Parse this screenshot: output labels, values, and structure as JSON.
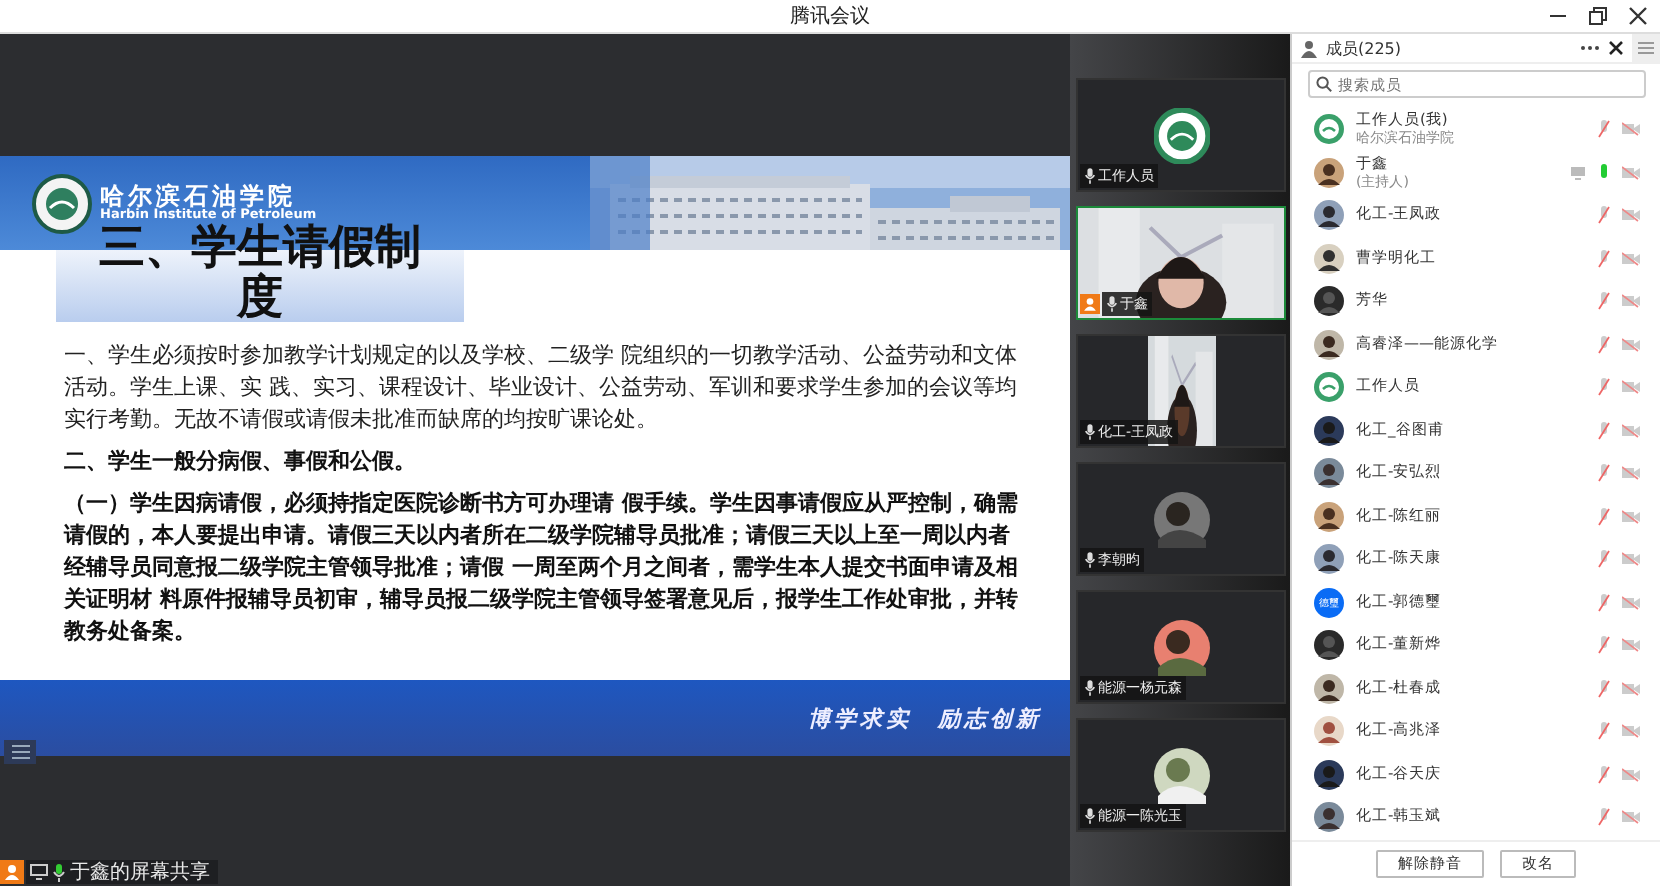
{
  "window": {
    "title": "腾讯会议"
  },
  "slide": {
    "school_name": "哈尔滨石油学院",
    "school_name_en": "Harbin Institute of Petroleum",
    "title": "三、学生请假制度",
    "paragraphs": [
      {
        "kind": "normal",
        "text": "一、学生必须按时参加教学计划规定的以及学校、二级学 院组织的一切教学活动、公益劳动和文体活动。学生上课、实 践、实习、课程设计、毕业设计、公益劳动、军训和要求学生参加的会议等均实行考勤。无故不请假或请假未批准而缺席的均按旷课论处。"
      },
      {
        "kind": "bold",
        "text": "二、学生一般分病假、事假和公假。"
      },
      {
        "kind": "bold",
        "text": "（一）学生因病请假，必须持指定医院诊断书方可办理请 假手续。学生因事请假应从严控制，确需请假的，本人要提出申请。请假三天以内者所在二级学院辅导员批准；请假三天以上至一周以内者经辅导员同意报二级学院主管领导批准；请假 一周至两个月之间者，需学生本人提交书面申请及相关证明材 料原件报辅导员初审，辅导员报二级学院主管领导签署意见后，报学生工作处审批，并转教务处备案。"
      }
    ],
    "motto": "博学求实　励志创新"
  },
  "share_bar": {
    "label": "于鑫的屏幕共享"
  },
  "videos": [
    {
      "name": "工作人员",
      "kind": "logo",
      "speaking": false,
      "host": false
    },
    {
      "name": "于鑫",
      "kind": "picture",
      "speaking": true,
      "host": true
    },
    {
      "name": "化工-王凤政",
      "kind": "picture",
      "speaking": false,
      "host": false
    },
    {
      "name": "李朝昀",
      "kind": "avatar",
      "speaking": false,
      "host": false
    },
    {
      "name": "能源一杨元森",
      "kind": "avatar",
      "speaking": false,
      "host": false
    },
    {
      "name": "能源一陈光玉",
      "kind": "avatar",
      "speaking": false,
      "host": false
    }
  ],
  "members_panel": {
    "title": "成员(225)",
    "search": {
      "placeholder": "搜索成员"
    },
    "members": [
      {
        "name": "工作人员(我)",
        "subtitle": "哈尔滨石油学院",
        "kind": "logo",
        "mic_on": false,
        "sharing": false
      },
      {
        "name": "于鑫",
        "subtitle": "(主持人)",
        "kind": "picture",
        "mic_on": true,
        "sharing": true
      },
      {
        "name": "化工-王凤政",
        "kind": "picture",
        "mic_on": false,
        "sharing": false
      },
      {
        "name": "曹学明化工",
        "kind": "picture",
        "mic_on": false,
        "sharing": false
      },
      {
        "name": "芳华",
        "kind": "picture",
        "mic_on": false,
        "sharing": false
      },
      {
        "name": "高睿泽——能源化学",
        "kind": "picture",
        "mic_on": false,
        "sharing": false
      },
      {
        "name": "工作人员",
        "kind": "logo",
        "mic_on": false,
        "sharing": false
      },
      {
        "name": "化工_谷图甫",
        "kind": "picture",
        "mic_on": false,
        "sharing": false
      },
      {
        "name": "化工-安弘烈",
        "kind": "picture",
        "mic_on": false,
        "sharing": false
      },
      {
        "name": "化工-陈红丽",
        "kind": "picture",
        "mic_on": false,
        "sharing": false
      },
      {
        "name": "化工-陈天康",
        "kind": "picture",
        "mic_on": false,
        "sharing": false
      },
      {
        "name": "化工-郭德璽",
        "kind": "initials",
        "initials": "德璽",
        "mic_on": false,
        "sharing": false
      },
      {
        "name": "化工-董新烨",
        "kind": "picture",
        "mic_on": false,
        "sharing": false
      },
      {
        "name": "化工-杜春成",
        "kind": "picture",
        "mic_on": false,
        "sharing": false
      },
      {
        "name": "化工-高兆泽",
        "kind": "picture",
        "mic_on": false,
        "sharing": false
      },
      {
        "name": "化工-谷天庆",
        "kind": "picture",
        "mic_on": false,
        "sharing": false
      },
      {
        "name": "化工-韩玉斌",
        "kind": "picture",
        "mic_on": false,
        "sharing": false
      }
    ],
    "buttons": [
      "解除静音",
      "改名"
    ]
  }
}
